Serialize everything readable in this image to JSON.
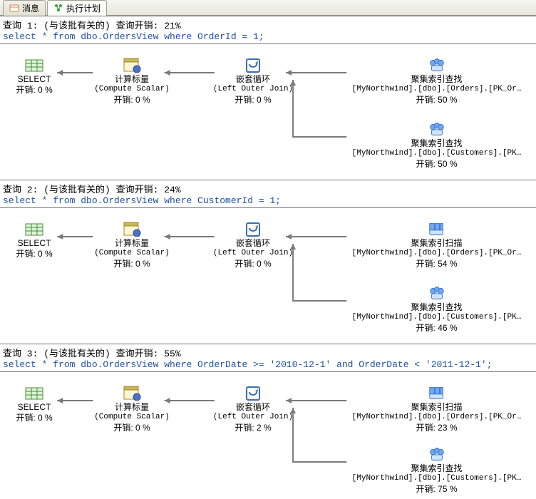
{
  "tabs": [
    {
      "label": "消息",
      "iconColor": "#c58a3b"
    },
    {
      "label": "执行计划",
      "iconColor": "#3b9e3b"
    }
  ],
  "queries": [
    {
      "title": "查询 1: (与该批有关的) 查询开销: 21%",
      "sql": "select * from dbo.OrdersView where OrderId = 1;",
      "nodes": {
        "select": {
          "label": "SELECT",
          "cost": "开销: 0 %"
        },
        "scalar": {
          "label": "计算标量",
          "detail": "(Compute Scalar)",
          "cost": "开销: 0 %"
        },
        "loop": {
          "label": "嵌套循环",
          "detail": "(Left Outer Join)",
          "cost": "开销: 0 %"
        },
        "top": {
          "label": "聚集索引查找",
          "detail": "[MyNorthwind].[dbo].[Orders].[PK_Or…",
          "cost": "开销: 50 %",
          "type": "seek"
        },
        "bottom": {
          "label": "聚集索引查找",
          "detail": "[MyNorthwind].[dbo].[Customers].[PK…",
          "cost": "开销: 50 %",
          "type": "seek"
        }
      }
    },
    {
      "title": "查询 2: (与该批有关的) 查询开销: 24%",
      "sql": "select * from dbo.OrdersView where CustomerId = 1;",
      "nodes": {
        "select": {
          "label": "SELECT",
          "cost": "开销: 0 %"
        },
        "scalar": {
          "label": "计算标量",
          "detail": "(Compute Scalar)",
          "cost": "开销: 0 %"
        },
        "loop": {
          "label": "嵌套循环",
          "detail": "(Left Outer Join)",
          "cost": "开销: 0 %"
        },
        "top": {
          "label": "聚集索引扫描",
          "detail": "[MyNorthwind].[dbo].[Orders].[PK_Or…",
          "cost": "开销: 54 %",
          "type": "scan"
        },
        "bottom": {
          "label": "聚集索引查找",
          "detail": "[MyNorthwind].[dbo].[Customers].[PK…",
          "cost": "开销: 46 %",
          "type": "seek"
        }
      }
    },
    {
      "title": "查询 3: (与该批有关的) 查询开销: 55%",
      "sql": "select * from dbo.OrdersView where OrderDate >= '2010-12-1' and OrderDate < '2011-12-1';",
      "nodes": {
        "select": {
          "label": "SELECT",
          "cost": "开销: 0 %"
        },
        "scalar": {
          "label": "计算标量",
          "detail": "(Compute Scalar)",
          "cost": "开销: 0 %"
        },
        "loop": {
          "label": "嵌套循环",
          "detail": "(Left Outer Join)",
          "cost": "开销: 2 %"
        },
        "top": {
          "label": "聚集索引扫描",
          "detail": "[MyNorthwind].[dbo].[Orders].[PK_Or…",
          "cost": "开销: 23 %",
          "type": "scan"
        },
        "bottom": {
          "label": "聚集索引查找",
          "detail": "[MyNorthwind].[dbo].[Customers].[PK…",
          "cost": "开销: 75 %",
          "type": "seek"
        }
      }
    }
  ]
}
